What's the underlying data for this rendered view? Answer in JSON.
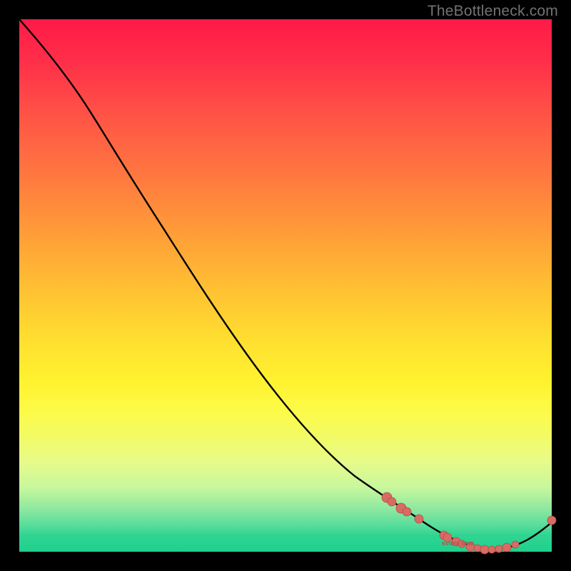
{
  "watermark": "TheBottleneck.com",
  "chart_data": {
    "type": "line",
    "title": "",
    "xlabel": "",
    "ylabel": "",
    "xlim": [
      0,
      100
    ],
    "ylim": [
      0,
      100
    ],
    "series_label": "NVIDIA GRID",
    "background_gradient": {
      "top": "#ff1a47",
      "mid": "#ffde30",
      "bottom": "#1fd08d"
    },
    "curve": [
      {
        "x": 0,
        "y": 100
      },
      {
        "x": 12,
        "y": 85
      },
      {
        "x": 27,
        "y": 61
      },
      {
        "x": 50,
        "y": 25
      },
      {
        "x": 63,
        "y": 14
      },
      {
        "x": 75,
        "y": 6
      },
      {
        "x": 84,
        "y": 1.5
      },
      {
        "x": 90,
        "y": 0.5
      },
      {
        "x": 95,
        "y": 2
      },
      {
        "x": 100,
        "y": 5.5
      }
    ],
    "markers": [
      {
        "x": 69,
        "y": 10.2
      },
      {
        "x": 70,
        "y": 9.4
      },
      {
        "x": 71.7,
        "y": 8.2
      },
      {
        "x": 72.8,
        "y": 7.5
      },
      {
        "x": 75.1,
        "y": 6.2
      },
      {
        "x": 79.8,
        "y": 3.1
      },
      {
        "x": 80.4,
        "y": 2.7
      },
      {
        "x": 82.0,
        "y": 1.9
      },
      {
        "x": 83.1,
        "y": 1.5
      },
      {
        "x": 84.7,
        "y": 0.9
      },
      {
        "x": 86.1,
        "y": 0.7
      },
      {
        "x": 87.4,
        "y": 0.4
      },
      {
        "x": 88.7,
        "y": 0.4
      },
      {
        "x": 90.1,
        "y": 0.5
      },
      {
        "x": 91.6,
        "y": 0.8
      },
      {
        "x": 93.2,
        "y": 1.3
      },
      {
        "x": 100,
        "y": 5.9
      }
    ],
    "marker_color": "#d86b64"
  }
}
